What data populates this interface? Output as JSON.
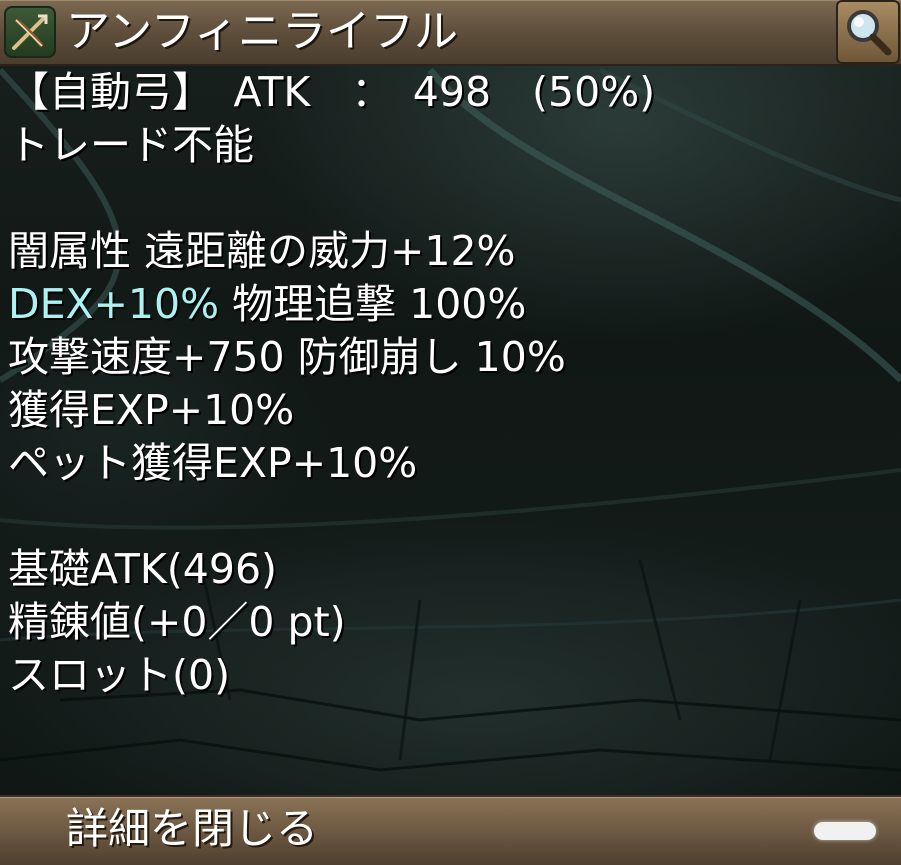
{
  "window": {
    "title": "アンフィニライフル"
  },
  "icons": {
    "item": "crossbow-icon",
    "search": "magnifier-icon"
  },
  "details": {
    "line_type_atk": "【自動弓】　ATK　：　498　(50%)",
    "line_trade": "トレード不能",
    "line_option_1": "闇属性 遠距離の威力+12%",
    "line_option_2_dex": "DEX+10%",
    "line_option_2_rest": " 物理追撃 100%",
    "line_option_3": "攻撃速度+750 防御崩し 10%",
    "line_option_4": "獲得EXP+10%",
    "line_option_5": "ペット獲得EXP+10%",
    "line_base_atk": "基礎ATK(496)",
    "line_refine": "精錬値(+0／0 pt)",
    "line_slot": "スロット(0)"
  },
  "footer": {
    "close_label": "詳細を閉じる"
  },
  "colors": {
    "highlight_text": "#aef1f2",
    "title_bar": "#6a5842",
    "background": "#121a18"
  }
}
